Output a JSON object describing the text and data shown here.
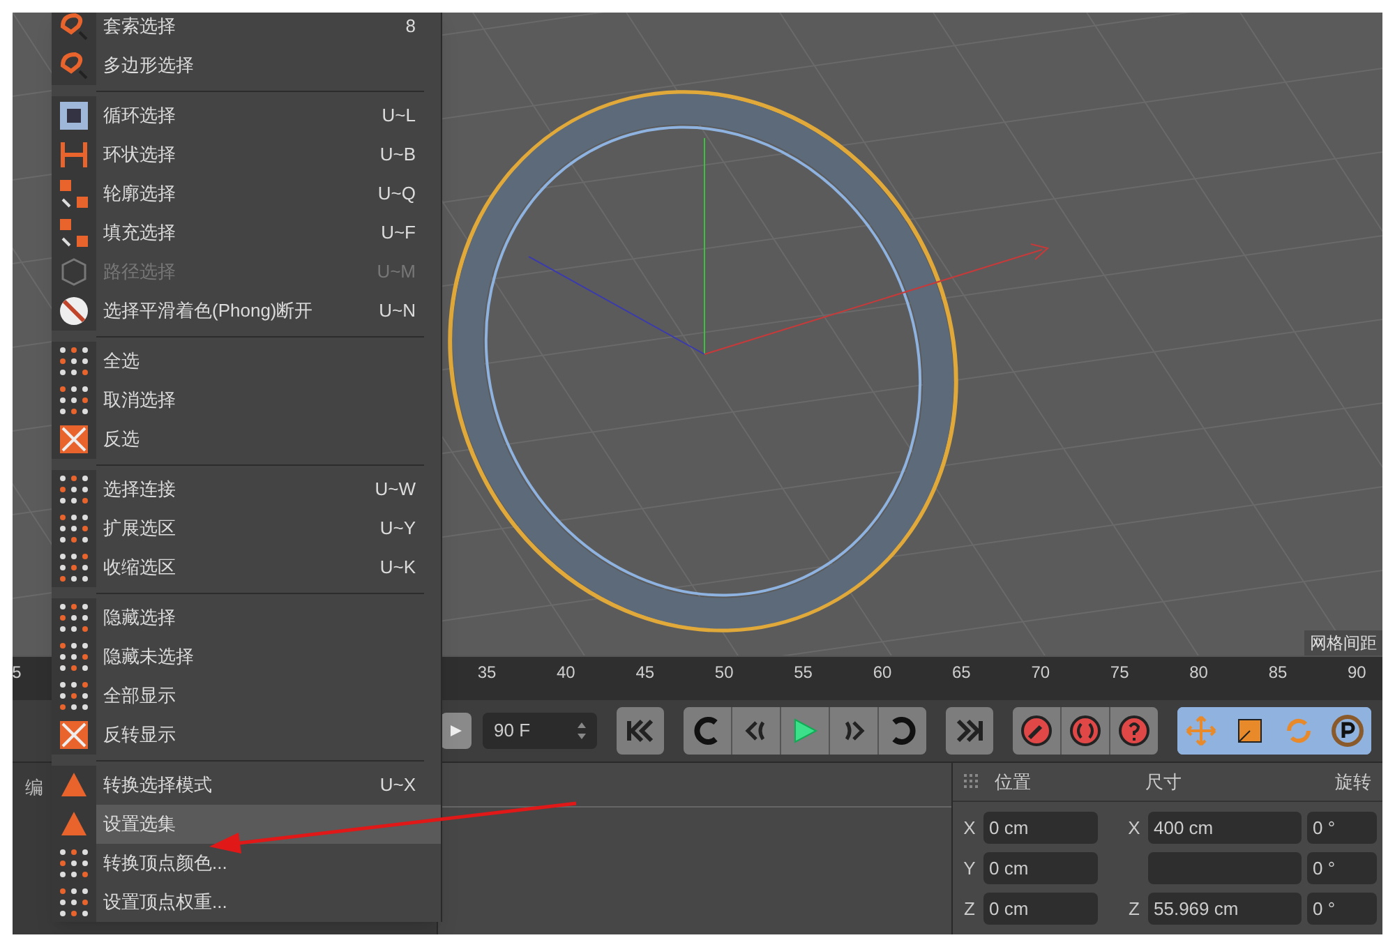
{
  "menu": {
    "groups": [
      {
        "items": [
          {
            "label": "套索选择",
            "shortcut": "8",
            "disabled": false,
            "selected": false
          },
          {
            "label": "多边形选择",
            "disabled": false,
            "selected": false
          }
        ]
      },
      {
        "items": [
          {
            "label": "循环选择",
            "shortcut": "U~L",
            "disabled": false,
            "selected": false
          },
          {
            "label": "环状选择",
            "shortcut": "U~B",
            "disabled": false,
            "selected": false
          },
          {
            "label": "轮廓选择",
            "shortcut": "U~Q",
            "disabled": false,
            "selected": false
          },
          {
            "label": "填充选择",
            "shortcut": "U~F",
            "disabled": false,
            "selected": false
          },
          {
            "label": "路径选择",
            "shortcut": "U~M",
            "disabled": true,
            "selected": false
          },
          {
            "label": "选择平滑着色(Phong)断开",
            "shortcut": "U~N",
            "disabled": false,
            "selected": false
          }
        ]
      },
      {
        "items": [
          {
            "label": "全选",
            "disabled": false,
            "selected": false
          },
          {
            "label": "取消选择",
            "disabled": false,
            "selected": false
          },
          {
            "label": "反选",
            "disabled": false,
            "selected": false
          }
        ]
      },
      {
        "items": [
          {
            "label": "选择连接",
            "shortcut": "U~W",
            "disabled": false,
            "selected": false
          },
          {
            "label": "扩展选区",
            "shortcut": "U~Y",
            "disabled": false,
            "selected": false
          },
          {
            "label": "收缩选区",
            "shortcut": "U~K",
            "disabled": false,
            "selected": false
          }
        ]
      },
      {
        "items": [
          {
            "label": "隐藏选择",
            "disabled": false,
            "selected": false
          },
          {
            "label": "隐藏未选择",
            "disabled": false,
            "selected": false
          },
          {
            "label": "全部显示",
            "disabled": false,
            "selected": false
          },
          {
            "label": "反转显示",
            "disabled": false,
            "selected": false
          }
        ]
      },
      {
        "items": [
          {
            "label": "转换选择模式",
            "shortcut": "U~X",
            "disabled": false,
            "selected": false
          },
          {
            "label": "设置选集",
            "disabled": false,
            "selected": true
          },
          {
            "label": "转换顶点颜色...",
            "disabled": false,
            "selected": false
          },
          {
            "label": "设置顶点权重...",
            "disabled": false,
            "selected": false
          }
        ]
      }
    ]
  },
  "viewport": {
    "label": "网格间距"
  },
  "timeline": {
    "ticks": [
      "5",
      "35",
      "40",
      "45",
      "50",
      "55",
      "60",
      "65",
      "70",
      "75",
      "80",
      "85",
      "90"
    ]
  },
  "playback": {
    "frame_field": "90 F"
  },
  "left_panel": {
    "label": "编"
  },
  "coordinates": {
    "headers": [
      "位置",
      "尺寸",
      "旋转"
    ],
    "rows": [
      {
        "axis": "X",
        "position": "0 cm",
        "size_axis": "X",
        "size": "400 cm",
        "rotation": "0 °"
      },
      {
        "axis": "Y",
        "position": "0 cm",
        "rotation": "0 °"
      },
      {
        "axis": "Z",
        "position": "0 cm",
        "size_axis": "Z",
        "size": "55.969 cm",
        "rotation": "0 °"
      }
    ]
  }
}
